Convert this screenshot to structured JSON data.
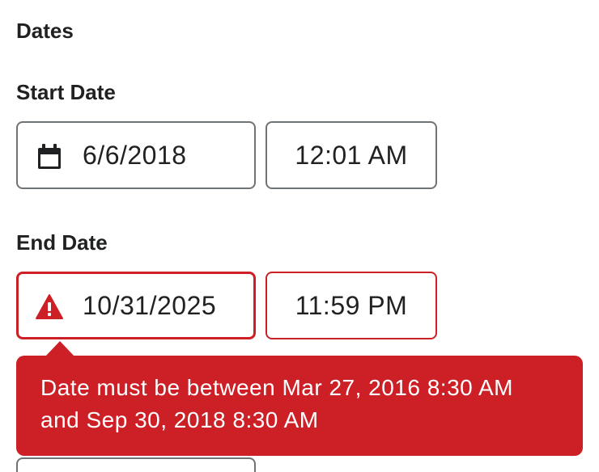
{
  "section": {
    "title": "Dates"
  },
  "start": {
    "label": "Start Date",
    "date_value": "6/6/2018",
    "date_icon": "calendar-icon",
    "time_value": "12:01 AM"
  },
  "end": {
    "label": "End Date",
    "date_value": "10/31/2025",
    "date_icon": "warning-icon",
    "time_value": "11:59 PM",
    "error_line1": "Date must be between Mar 27, 2016 8:30 AM",
    "error_line2": "and Sep 30, 2018 8:30 AM"
  },
  "colors": {
    "text": "#202122",
    "border": "#6e7376",
    "error": "#cd2026",
    "background": "#ffffff"
  }
}
